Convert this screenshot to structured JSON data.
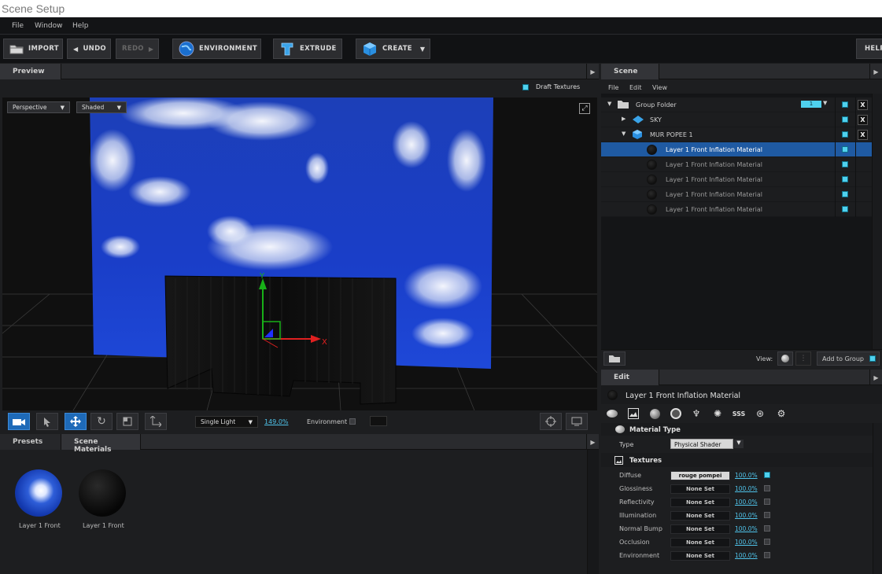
{
  "window": {
    "title": "Scene Setup"
  },
  "menubar": {
    "items": [
      "File",
      "Window",
      "Help"
    ]
  },
  "toolbar": {
    "import": "IMPORT",
    "undo": "UNDO",
    "redo": "REDO",
    "environment": "ENVIRONMENT",
    "extrude": "EXTRUDE",
    "create": "CREATE",
    "help": "HELP"
  },
  "preview": {
    "tab": "Preview",
    "draft_textures": "Draft Textures",
    "camera_mode": "Perspective",
    "shading_mode": "Shaded",
    "lighting": "Single Light",
    "zoom": "149.0%",
    "environment_label": "Environment",
    "axis_y": "Y",
    "axis_x": "X"
  },
  "presets": {
    "tabs": [
      "Presets",
      "Scene Materials"
    ],
    "materials": [
      {
        "label": "Layer 1 Front",
        "type": "sky"
      },
      {
        "label": "Layer 1 Front",
        "type": "black"
      }
    ]
  },
  "scene": {
    "tab": "Scene",
    "menu": [
      "File",
      "Edit",
      "View"
    ],
    "group_badge": "1",
    "tree": [
      {
        "label": "Group Folder",
        "level": 0,
        "kind": "folder",
        "expanded": true,
        "closable": true
      },
      {
        "label": "SKY",
        "level": 1,
        "kind": "plane",
        "expanded": false,
        "closable": true
      },
      {
        "label": "MUR POPEE 1",
        "level": 1,
        "kind": "mesh",
        "expanded": true,
        "closable": true
      },
      {
        "label": "Layer 1 Front Inflation Material",
        "level": 2,
        "kind": "material",
        "selected": true
      },
      {
        "label": "Layer 1 Front Inflation Material",
        "level": 2,
        "kind": "material"
      },
      {
        "label": "Layer 1 Front Inflation Material",
        "level": 2,
        "kind": "material"
      },
      {
        "label": "Layer 1 Front Inflation Material",
        "level": 2,
        "kind": "material"
      },
      {
        "label": "Layer 1 Front Inflation Material",
        "level": 2,
        "kind": "material"
      }
    ],
    "view_label": "View:",
    "add_to_group": "Add to Group"
  },
  "edit": {
    "tab": "Edit",
    "title": "Layer 1 Front Inflation Material",
    "material_type_header": "Material Type",
    "type_label": "Type",
    "type_value": "Physical Shader",
    "textures_header": "Textures",
    "textures": [
      {
        "name": "Diffuse",
        "value": "rouge pompei",
        "pct": "100.0%",
        "on": true
      },
      {
        "name": "Glossiness",
        "value": "None Set",
        "pct": "100.0%",
        "on": false
      },
      {
        "name": "Reflectivity",
        "value": "None Set",
        "pct": "100.0%",
        "on": false
      },
      {
        "name": "Illumination",
        "value": "None Set",
        "pct": "100.0%",
        "on": false
      },
      {
        "name": "Normal Bump",
        "value": "None Set",
        "pct": "100.0%",
        "on": false
      },
      {
        "name": "Occlusion",
        "value": "None Set",
        "pct": "100.0%",
        "on": false
      },
      {
        "name": "Environment",
        "value": "None Set",
        "pct": "100.0%",
        "on": false
      }
    ]
  },
  "colors": {
    "accent": "#4fd1ee",
    "selection": "#1f5aa2",
    "axis_x": "#e02020",
    "axis_y": "#18b018"
  }
}
